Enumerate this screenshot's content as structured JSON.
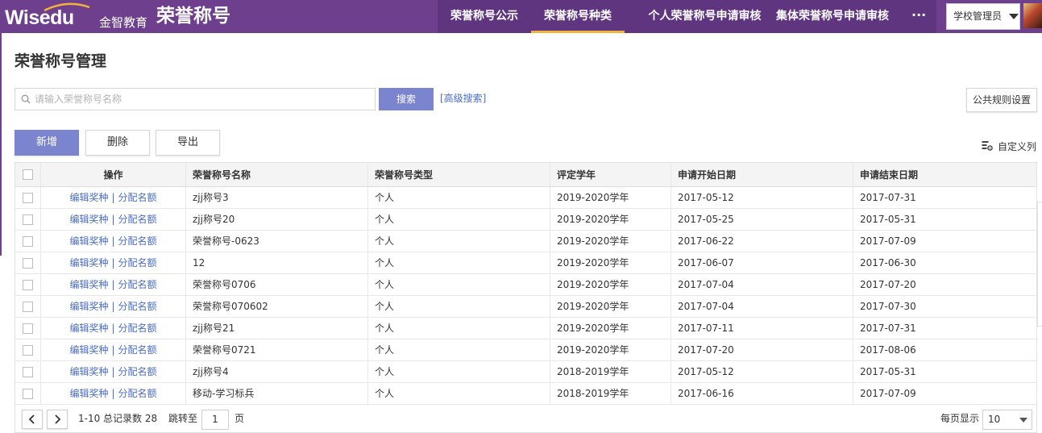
{
  "header": {
    "logo_text": "Wisedu",
    "logo_sub": "金智教育",
    "app_title": "荣誉称号",
    "nav": [
      {
        "label": "荣誉称号公示"
      },
      {
        "label": "荣誉称号种类"
      },
      {
        "label": "个人荣誉称号申请审核"
      },
      {
        "label": "集体荣誉称号申请审核"
      }
    ],
    "more_label": "···",
    "role": "学校管理员"
  },
  "page": {
    "title": "荣誉称号管理"
  },
  "search": {
    "placeholder": "请输入荣誉称号名称",
    "button": "搜索",
    "advanced": "[高级搜索]"
  },
  "toolbar": {
    "public_rules": "公共规则设置",
    "add": "新增",
    "delete": "删除",
    "export": "导出",
    "custom_columns": "自定义列"
  },
  "table": {
    "columns": [
      "操作",
      "荣誉称号名称",
      "荣誉称号类型",
      "评定学年",
      "申请开始日期",
      "申请结束日期"
    ],
    "op_edit": "编辑奖种",
    "op_sep": "|",
    "op_assign": "分配名额",
    "rows": [
      {
        "name": "zjj称号3",
        "type": "个人",
        "year": "2019-2020学年",
        "start": "2017-05-12",
        "end": "2017-07-31"
      },
      {
        "name": "zjj称号20",
        "type": "个人",
        "year": "2019-2020学年",
        "start": "2017-05-25",
        "end": "2017-05-31"
      },
      {
        "name": "荣誉称号-0623",
        "type": "个人",
        "year": "2019-2020学年",
        "start": "2017-06-22",
        "end": "2017-07-09"
      },
      {
        "name": "12",
        "type": "个人",
        "year": "2019-2020学年",
        "start": "2017-06-07",
        "end": "2017-06-30"
      },
      {
        "name": "荣誉称号0706",
        "type": "个人",
        "year": "2019-2020学年",
        "start": "2017-07-04",
        "end": "2017-07-20"
      },
      {
        "name": "荣誉称号070602",
        "type": "个人",
        "year": "2019-2020学年",
        "start": "2017-07-04",
        "end": "2017-07-30"
      },
      {
        "name": "zjj称号21",
        "type": "个人",
        "year": "2019-2020学年",
        "start": "2017-07-11",
        "end": "2017-07-31"
      },
      {
        "name": "荣誉称号0721",
        "type": "个人",
        "year": "2019-2020学年",
        "start": "2017-07-20",
        "end": "2017-08-06"
      },
      {
        "name": "zjj称号4",
        "type": "个人",
        "year": "2018-2019学年",
        "start": "2017-05-12",
        "end": "2017-05-31"
      },
      {
        "name": "移动-学习标兵",
        "type": "个人",
        "year": "2018-2019学年",
        "start": "2017-06-16",
        "end": "2017-07-09"
      }
    ]
  },
  "pager": {
    "summary": "1-10 总记录数 28",
    "jump_label": "跳转至",
    "page": "1",
    "page_unit": "页",
    "per_page_label": "每页显示",
    "per_page": "10"
  },
  "colors": {
    "header": "#6d3f8d",
    "nav": "#5f3580",
    "accent": "#7b85cf",
    "link": "#4a6cc8",
    "active_underline": "#f0b33c"
  }
}
